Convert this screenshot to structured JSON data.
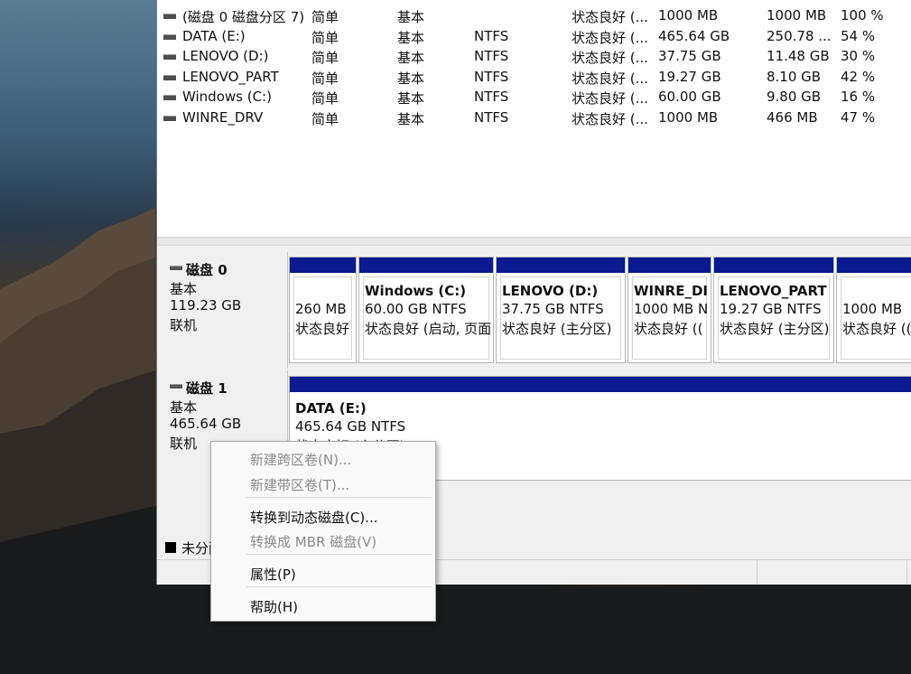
{
  "volumes": [
    {
      "name": "(磁盘 0 磁盘分区 7)",
      "layout": "简单",
      "type": "基本",
      "fs": "",
      "status": "状态良好 (...",
      "capacity": "1000 MB",
      "free": "1000 MB",
      "pct": "100 %"
    },
    {
      "name": "DATA (E:)",
      "layout": "简单",
      "type": "基本",
      "fs": "NTFS",
      "status": "状态良好 (...",
      "capacity": "465.64 GB",
      "free": "250.78 ...",
      "pct": "54 %"
    },
    {
      "name": "LENOVO (D:)",
      "layout": "简单",
      "type": "基本",
      "fs": "NTFS",
      "status": "状态良好 (...",
      "capacity": "37.75 GB",
      "free": "11.48 GB",
      "pct": "30 %"
    },
    {
      "name": "LENOVO_PART",
      "layout": "简单",
      "type": "基本",
      "fs": "NTFS",
      "status": "状态良好 (...",
      "capacity": "19.27 GB",
      "free": "8.10 GB",
      "pct": "42 %"
    },
    {
      "name": "Windows (C:)",
      "layout": "简单",
      "type": "基本",
      "fs": "NTFS",
      "status": "状态良好 (...",
      "capacity": "60.00 GB",
      "free": "9.80 GB",
      "pct": "16 %"
    },
    {
      "name": "WINRE_DRV",
      "layout": "简单",
      "type": "基本",
      "fs": "NTFS",
      "status": "状态良好 (...",
      "capacity": "1000 MB",
      "free": "466 MB",
      "pct": "47 %"
    }
  ],
  "disk0": {
    "name": "磁盘 0",
    "type": "基本",
    "size": "119.23 GB",
    "state": "联机",
    "partitions": [
      {
        "title": "",
        "size": "260 MB",
        "status": "状态良好"
      },
      {
        "title": "Windows  (C:)",
        "size": "60.00 GB NTFS",
        "status": "状态良好 (启动, 页面"
      },
      {
        "title": "LENOVO  (D:)",
        "size": "37.75 GB NTFS",
        "status": "状态良好 (主分区)"
      },
      {
        "title": "WINRE_DI",
        "size": "1000 MB N",
        "status": "状态良好 (("
      },
      {
        "title": "LENOVO_PART",
        "size": "19.27 GB NTFS",
        "status": "状态良好 (主分区)"
      },
      {
        "title": "",
        "size": "1000 MB",
        "status": "状态良好 (("
      }
    ]
  },
  "disk1": {
    "name": "磁盘 1",
    "type": "基本",
    "size": "465.64 GB",
    "state": "联机",
    "partition": {
      "title": "DATA  (E:)",
      "size": "465.64 GB NTFS",
      "status": "状态良好 (主分区)"
    }
  },
  "legend": {
    "unallocated": "未分配"
  },
  "context_menu": {
    "items": [
      {
        "label": "新建跨区卷(N)...",
        "enabled": false
      },
      {
        "label": "新建带区卷(T)...",
        "enabled": false
      },
      {
        "label": "转换到动态磁盘(C)...",
        "enabled": true
      },
      {
        "label": "转换成 MBR 磁盘(V)",
        "enabled": false
      },
      {
        "label": "属性(P)",
        "enabled": true
      },
      {
        "label": "帮助(H)",
        "enabled": true
      }
    ]
  },
  "colors": {
    "partition_bar": "#0b1a8f",
    "window_bg": "#f0f0f0"
  }
}
